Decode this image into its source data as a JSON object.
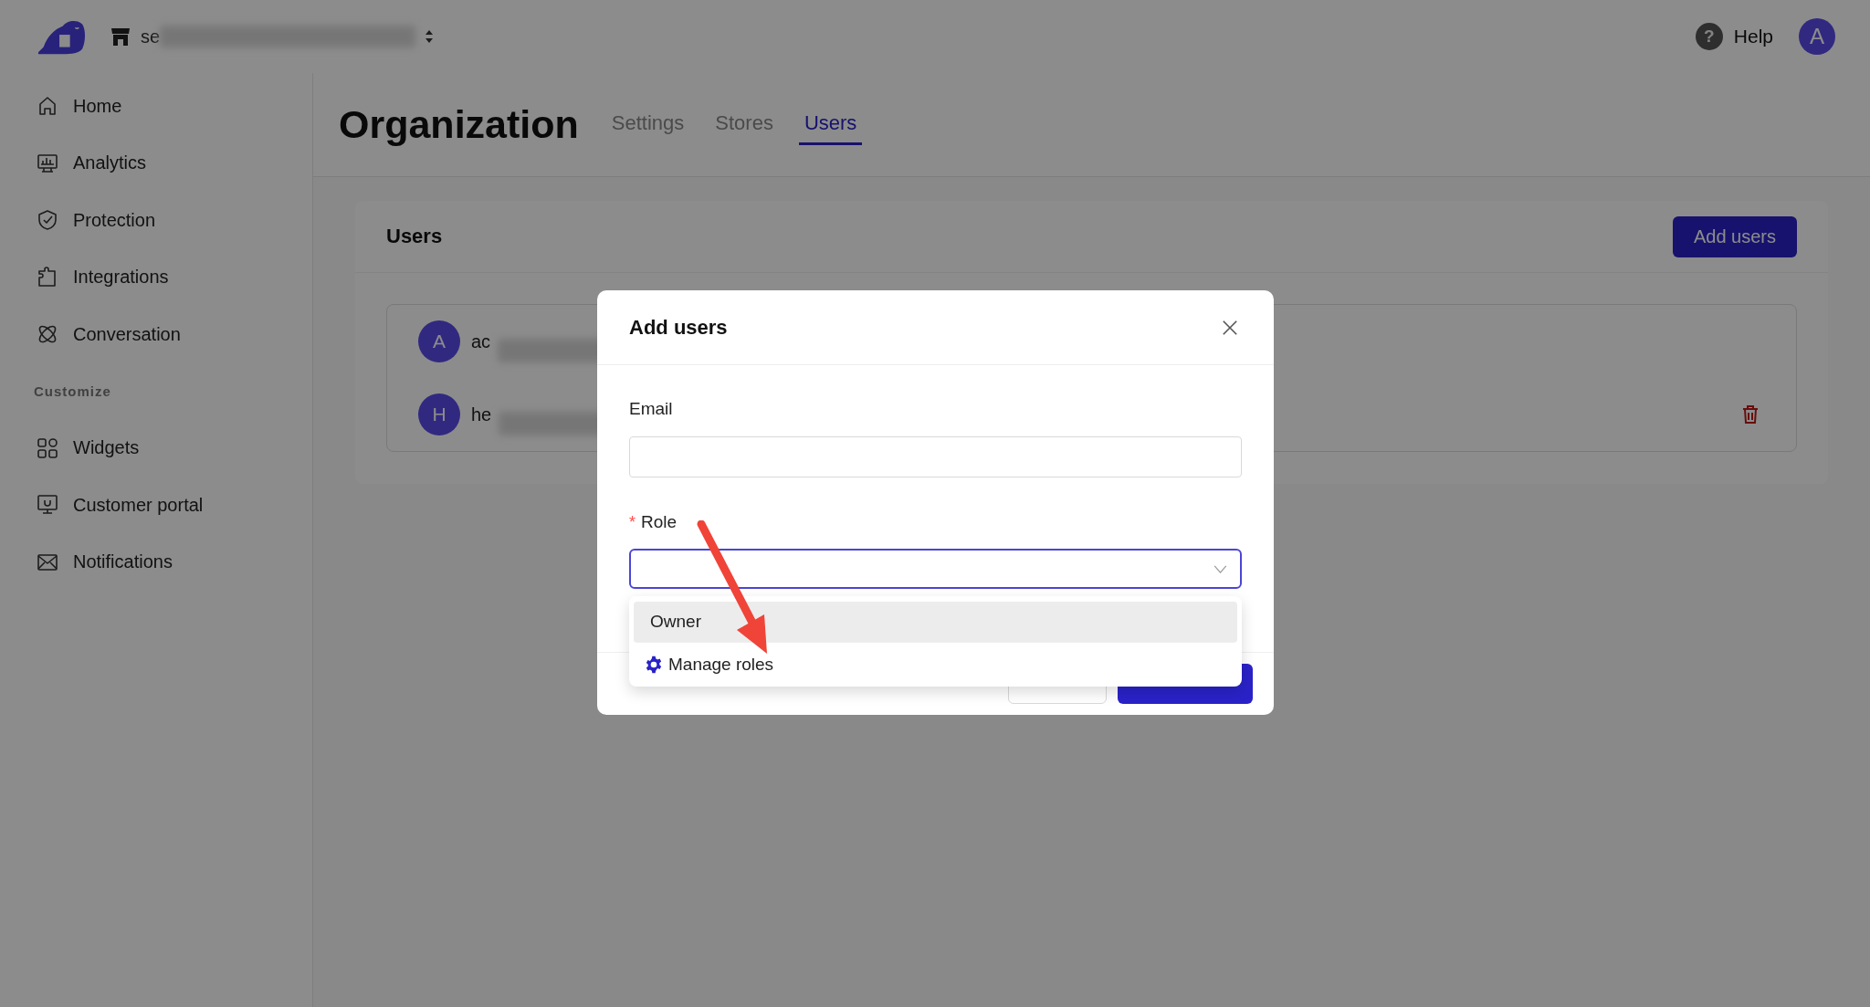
{
  "header": {
    "store": "se",
    "help_icon": "?",
    "help": "Help",
    "avatar": "A"
  },
  "sidebar": {
    "groups": [
      {
        "items": [
          {
            "label": "Home",
            "kind": "home"
          },
          {
            "label": "Analytics",
            "kind": "analytics"
          },
          {
            "label": "Protection",
            "kind": "shield"
          },
          {
            "label": "Integrations",
            "kind": "puzzle"
          },
          {
            "label": "Conversation",
            "kind": "chat"
          }
        ]
      },
      {
        "heading": "Customize",
        "items": [
          {
            "label": "Widgets",
            "kind": "grid"
          },
          {
            "label": "Customer portal",
            "kind": "portal"
          },
          {
            "label": "Notifications",
            "kind": "mail"
          }
        ]
      }
    ]
  },
  "page": {
    "title": "Organization",
    "tabs": [
      {
        "label": "Settings",
        "selected": false
      },
      {
        "label": "Stores",
        "selected": false
      },
      {
        "label": "Users",
        "selected": true
      }
    ]
  },
  "card": {
    "title": "Users",
    "button": "Add users",
    "users": [
      {
        "initial": "A",
        "name": "ac",
        "deletable": false
      },
      {
        "initial": "H",
        "name": "he",
        "deletable": true
      }
    ]
  },
  "modal": {
    "title": "Add users",
    "email_label": "Email",
    "role_label": "Role",
    "required_mark": "*",
    "options": [
      {
        "label": "Owner",
        "selected": true
      }
    ],
    "manage": "Manage roles"
  }
}
